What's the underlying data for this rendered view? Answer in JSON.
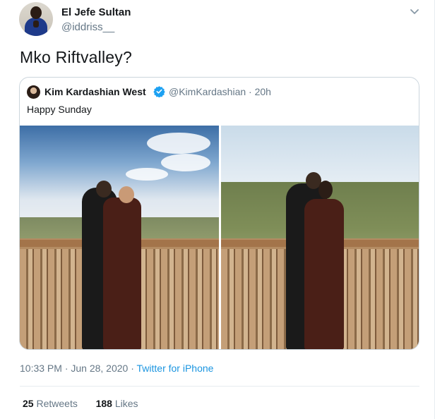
{
  "author": {
    "name": "El Jefe Sultan",
    "handle": "@iddriss__"
  },
  "tweet": {
    "text": "Mko Riftvalley?",
    "timestamp": "10:33 PM · Jun 28, 2020 · ",
    "source": "Twitter for iPhone"
  },
  "quoted": {
    "name": "Kim Kardashian West",
    "handle_time": "@KimKardashian · 20h",
    "text": "Happy Sunday"
  },
  "stats": {
    "retweets_count": "25",
    "retweets_label": "Retweets",
    "likes_count": "188",
    "likes_label": "Likes"
  },
  "colors": {
    "link": "#1b95e0",
    "muted": "#657786",
    "verified": "#1da1f2"
  }
}
